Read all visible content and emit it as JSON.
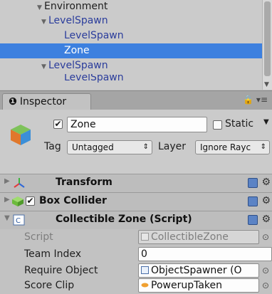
{
  "hierarchy": {
    "rows": [
      {
        "label": "Environment",
        "expanded": true
      },
      {
        "label": "LevelSpawn",
        "expanded": true
      },
      {
        "label": "LevelSpawn"
      },
      {
        "label": "Zone",
        "selected": true
      },
      {
        "label": "LevelSpawn",
        "expanded": true
      },
      {
        "label": "LevelSpawn"
      }
    ]
  },
  "inspector": {
    "tab_label": "Inspector",
    "tab_icon": "info-icon",
    "lock_icon": "lock-icon",
    "menu_icon": "menu-icon"
  },
  "gameobject": {
    "active": true,
    "name": "Zone",
    "static_label": "Static",
    "static_checked": false,
    "tag_label": "Tag",
    "tag_value": "Untagged",
    "layer_label": "Layer",
    "layer_value": "Ignore Rayc"
  },
  "components": {
    "transform": {
      "title": "Transform",
      "icon": "transform-axes-icon"
    },
    "box_collider": {
      "title": "Box Collider",
      "enabled": true,
      "icon": "box-collider-icon"
    },
    "collectible_zone": {
      "title": "Collectible Zone (Script)",
      "icon": "csharp-script-icon",
      "properties": {
        "script": {
          "label": "Script",
          "value": "CollectibleZone"
        },
        "team_index": {
          "label": "Team Index",
          "value": "0"
        },
        "require_object": {
          "label": "Require Object",
          "value": "ObjectSpawner (O"
        },
        "score_clip": {
          "label": "Score Clip",
          "value": "PowerupTaken"
        }
      }
    }
  },
  "colors": {
    "selection": "#3d80df",
    "hierarchy_text": "#2b3d9c",
    "panel": "#c2c2c2"
  }
}
